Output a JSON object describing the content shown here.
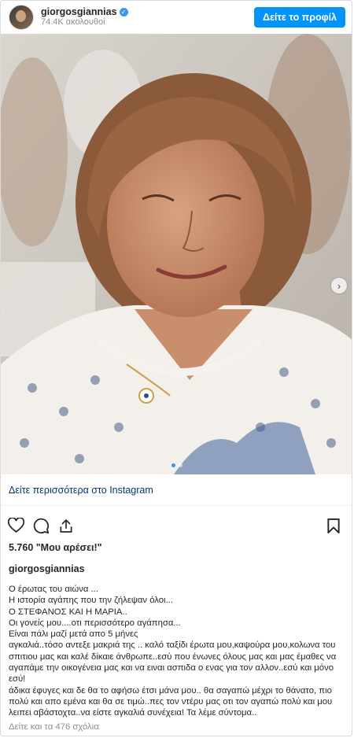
{
  "header": {
    "username": "giorgosgiannias",
    "followers": "74.4K ακολουθοί",
    "view_profile": "Δείτε το προφίλ"
  },
  "post": {
    "see_more": "Δείτε περισσότερα στο Instagram",
    "likes": "5.760 \"Μου αρέσει!\"",
    "owner": "giorgosgiannias",
    "caption_lines": [
      "Ο έρωτας του αιώνα ...",
      "Η ιστορία αγάπης που την ζήλεψαν όλοι...",
      "Ο ΣΤΕΦΑΝΟΣ ΚΑΙ Η ΜΑΡΙΑ..",
      "Οι γονείς μου....οτι περισσότερο αγάπησα...",
      "Είναι πάλι μαζί μετά απο 5 μήνες",
      "αγκαλιά..τόσο αντεξε μακριά της .. καλό ταξίδι έρωτα μου,καψούρα μου,κολωνα του σπιτιου μας και καλέ δίκαιε άνθρωπε..εσύ που ένωνες όλους μας και μας έμαθες να αγαπάμε την οικογένεια μας και να ειναι ασπιδα ο ενας για τον αλλον..εσύ και μόνο εσύ!",
      "άδικα έφυγες και δε θα το αφήσω έτσι μάνα μου.. θα σαγαπώ μέχρι το θάνατο, πιο πολύ και απο εμένα και θα σε τιμώ..πες τον ντέρυ μας οτι τον αγαπώ πολύ και μου λειπει αβάστοχτα..να είστε αγκαλιά συνέχεια! Τα λέμε σύντομα.."
    ],
    "comments": "Δείτε και τα 476 σχόλια"
  },
  "icons": [
    "verified-badge",
    "next-arrow",
    "heart-icon",
    "comment-icon",
    "share-icon",
    "bookmark-icon"
  ],
  "colors": {
    "accent": "#0095f6",
    "link": "#00376b",
    "muted": "#8e8e8e"
  }
}
